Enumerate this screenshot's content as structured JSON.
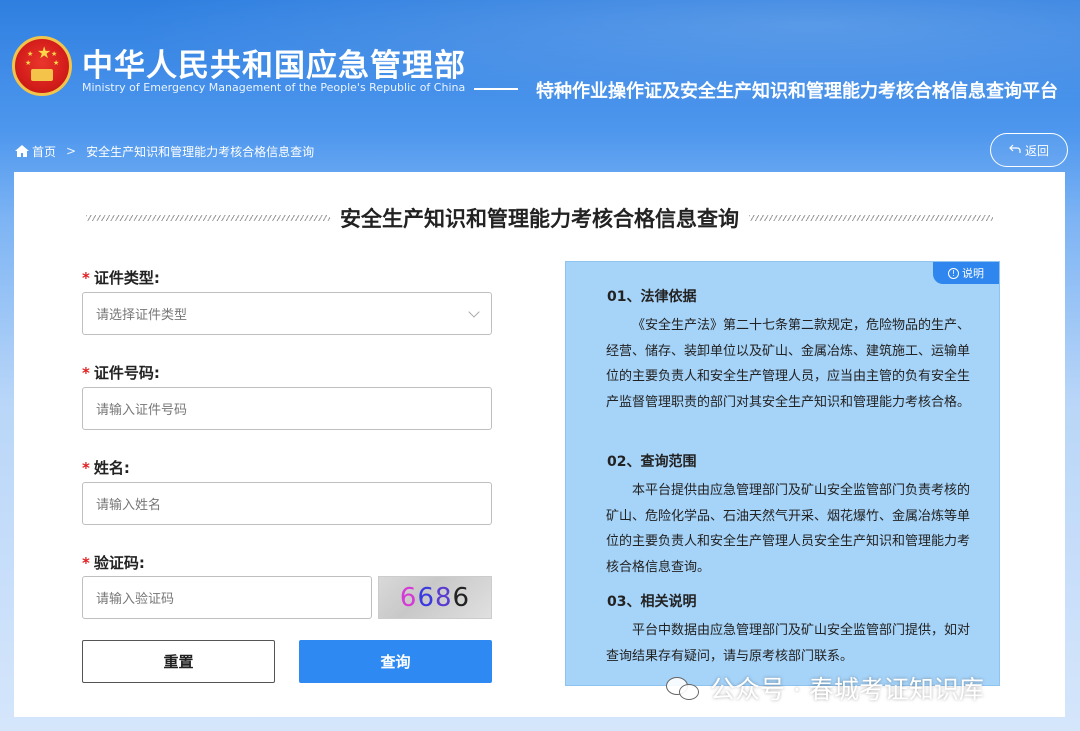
{
  "header": {
    "site_title": "中华人民共和国应急管理部",
    "site_subtitle": "Ministry of Emergency Management of the People's Republic of China",
    "platform_title": "特种作业操作证及安全生产知识和管理能力考核合格信息查询平台"
  },
  "breadcrumb": {
    "home_label": "首页",
    "separator": ">",
    "current_label": "安全生产知识和管理能力考核合格信息查询"
  },
  "back_button": {
    "label": "返回",
    "icon": "return-icon"
  },
  "panel": {
    "title": "安全生产知识和管理能力考核合格信息查询"
  },
  "form": {
    "required_mark": "*",
    "cert_type": {
      "label": "证件类型:",
      "placeholder": "请选择证件类型"
    },
    "cert_number": {
      "label": "证件号码:",
      "placeholder": "请输入证件号码"
    },
    "name": {
      "label": "姓名:",
      "placeholder": "请输入姓名"
    },
    "captcha": {
      "label": "验证码:",
      "placeholder": "请输入验证码",
      "image_text": "6686"
    },
    "reset_label": "重置",
    "query_label": "查询"
  },
  "info": {
    "badge": "说明",
    "sections": [
      {
        "heading": "01、法律依据",
        "text": "《安全生产法》第二十七条第二款规定，危险物品的生产、经营、储存、装卸单位以及矿山、金属冶炼、建筑施工、运输单位的主要负责人和安全生产管理人员，应当由主管的负有安全生产监督管理职责的部门对其安全生产知识和管理能力考核合格。"
      },
      {
        "heading": "02、查询范围",
        "text": "本平台提供由应急管理部门及矿山安全监管部门负责考核的矿山、危险化学品、石油天然气开采、烟花爆竹、金属冶炼等单位的主要负责人和安全生产管理人员安全生产知识和管理能力考核合格信息查询。"
      },
      {
        "heading": "03、相关说明",
        "text": "平台中数据由应急管理部门及矿山安全监管部门提供，如对查询结果存有疑问，请与原考核部门联系。"
      }
    ]
  },
  "watermark": {
    "text": "公众号 · 春城考证知识库"
  },
  "colors": {
    "header_blue": "#2f7fe0",
    "primary_button": "#2e8af2",
    "info_background": "#a6d3f8",
    "required_red": "#e02020"
  }
}
